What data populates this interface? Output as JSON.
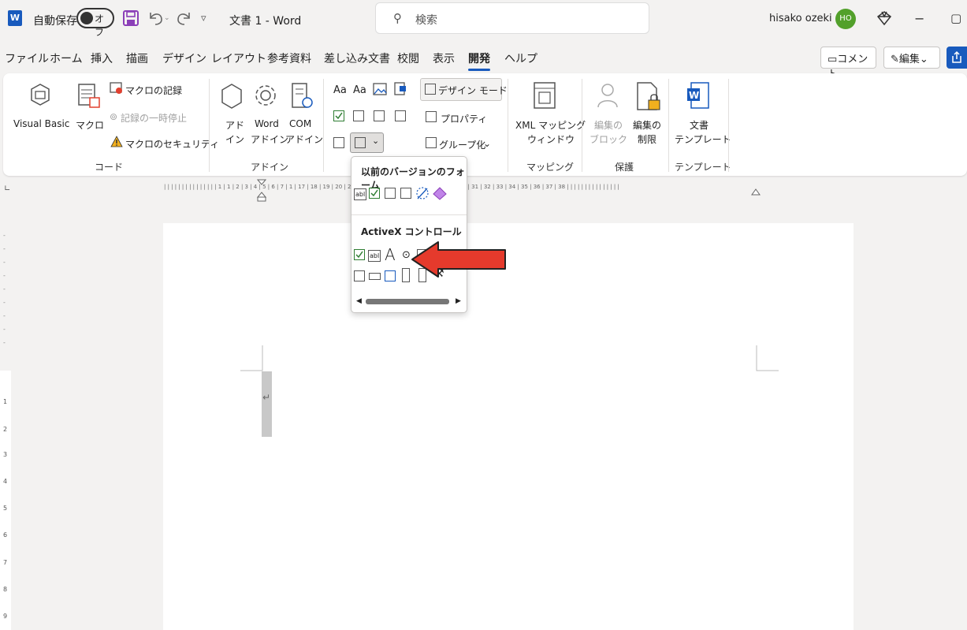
{
  "titlebar": {
    "app_icon": "W",
    "autosave_label": "自動保存",
    "autosave_state": "オフ",
    "qat_customize": "▿",
    "doc_title": "文書 1  -  Word",
    "search_placeholder": "検索",
    "user_name": "hisako ozeki",
    "user_initials": "HO",
    "minimize": "−",
    "restore": "▢"
  },
  "menu": {
    "tabs": [
      "ファイル",
      "ホーム",
      "挿入",
      "描画",
      "デザイン",
      "レイアウト",
      "参考資料",
      "差し込み文書",
      "校閲",
      "表示",
      "開発",
      "ヘルプ"
    ],
    "active_tab": "開発",
    "comment_button": "コメント",
    "edit_button": "編集",
    "edit_chevron": "⌄"
  },
  "ribbon": {
    "code": {
      "visual_basic": "Visual Basic",
      "macro": "マクロ",
      "record_macro": "マクロの記録",
      "pause_recording": "記録の一時停止",
      "macro_security": "マクロのセキュリティ",
      "group": "コード"
    },
    "addins": {
      "addins_line1": "アド",
      "addins_line2": "イン",
      "word_addins_line1": "Word",
      "word_addins_line2": "アドイン",
      "com_addins_line1": "COM",
      "com_addins_line2": "アドイン",
      "group": "アドイン"
    },
    "controls": {
      "aa1": "Aa",
      "aa2": "Aa",
      "design_mode": "デザイン モード",
      "properties": "プロパティ",
      "group_button": "グループ化",
      "chevron": "⌄"
    },
    "mapping": {
      "xml_line1": "XML マッピング",
      "xml_line2": "ウィンドウ",
      "group": "マッピング"
    },
    "protect": {
      "block_line1": "編集の",
      "block_line2": "ブロック",
      "restrict_line1": "編集の",
      "restrict_line2": "制限",
      "group": "保護"
    },
    "templates": {
      "doc_template_line1": "文書",
      "doc_template_line2": "テンプレート",
      "group": "テンプレート"
    }
  },
  "ruler": {
    "marks": "| | | | | | | | | | | | | | | 1 | 1 | 2 | 3 | 4 | 5 | 6 | 7   | 1 | 17 | 18 | 19 | 20 | 21 | 22 | 23 | 24 | 25 | 26 | 27 | 28 | 29 | 30 | 31 | 32 | 33 | 34 | 35 | 36 | 37 | 38 | | | | | | | | | | | | | | |"
  },
  "vruler": [
    "1",
    "2",
    "3",
    "4",
    "5",
    "6",
    "7",
    "8",
    "9"
  ],
  "dropdown": {
    "legacy_title": "以前のバージョンのフォーム",
    "activex_title": "ActiveX コントロール",
    "label_glyph": "A",
    "text_glyph": "abl"
  },
  "document": {
    "paragraph_mark": "↵"
  },
  "colors": {
    "accent": "#185abd",
    "avatar": "#52a02b",
    "arrow": "#e53a2c"
  }
}
